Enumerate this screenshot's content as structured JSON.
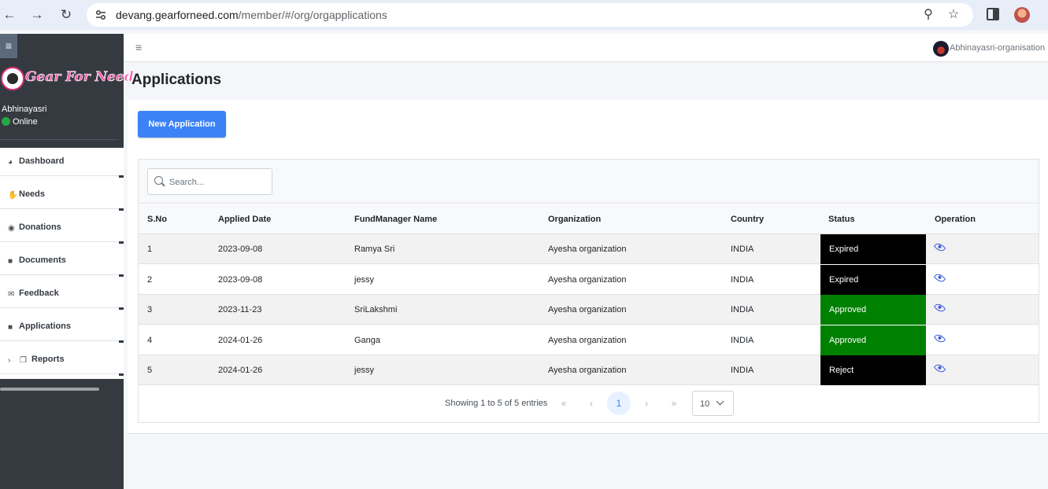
{
  "browser": {
    "url_host": "devang.gearforneed.com",
    "url_path": "/member/#/org/orgapplications"
  },
  "sidebar": {
    "brand": "Gear For Need",
    "user_name": "Abhinayasri",
    "user_status": "Online",
    "items": [
      {
        "label": "Dashboard",
        "icon": "dashboard-icon"
      },
      {
        "label": "Needs",
        "icon": "hand-holding-icon"
      },
      {
        "label": "Donations",
        "icon": "donation-icon"
      },
      {
        "label": "Documents",
        "icon": "file-icon"
      },
      {
        "label": "Feedback",
        "icon": "envelope-icon"
      },
      {
        "label": "Applications",
        "icon": "file-icon"
      },
      {
        "label": "Reports",
        "icon": "copy-icon"
      }
    ]
  },
  "topnav": {
    "user": "Abhinayasri-organisation"
  },
  "page": {
    "title": "Applications",
    "new_button": "New Application"
  },
  "search": {
    "placeholder": "Search..."
  },
  "table": {
    "columns": [
      "S.No",
      "Applied Date",
      "FundManager Name",
      "Organization",
      "Country",
      "Status",
      "Operation"
    ],
    "rows": [
      {
        "sno": "1",
        "date": "2023-09-08",
        "manager": "Ramya Sri",
        "org": "Ayesha organization",
        "country": "INDIA",
        "status": "Expired",
        "status_color": "#000000"
      },
      {
        "sno": "2",
        "date": "2023-09-08",
        "manager": "jessy",
        "org": "Ayesha organization",
        "country": "INDIA",
        "status": "Expired",
        "status_color": "#000000"
      },
      {
        "sno": "3",
        "date": "2023-11-23",
        "manager": "SriLakshmi",
        "org": "Ayesha organization",
        "country": "INDIA",
        "status": "Approved",
        "status_color": "#008000"
      },
      {
        "sno": "4",
        "date": "2024-01-26",
        "manager": "Ganga",
        "org": "Ayesha organization",
        "country": "INDIA",
        "status": "Approved",
        "status_color": "#008000"
      },
      {
        "sno": "5",
        "date": "2024-01-26",
        "manager": "jessy",
        "org": "Ayesha organization",
        "country": "INDIA",
        "status": "Reject",
        "status_color": "#000000"
      }
    ]
  },
  "pagination": {
    "info": "Showing 1 to 5 of 5 entries",
    "current_page": "1",
    "first": "«",
    "prev": "‹",
    "next": "›",
    "last": "»",
    "page_size": "10"
  },
  "colors": {
    "primary": "#3b82f6",
    "sidebar_bg": "#343a40",
    "approved": "#008000",
    "expired": "#000000"
  }
}
